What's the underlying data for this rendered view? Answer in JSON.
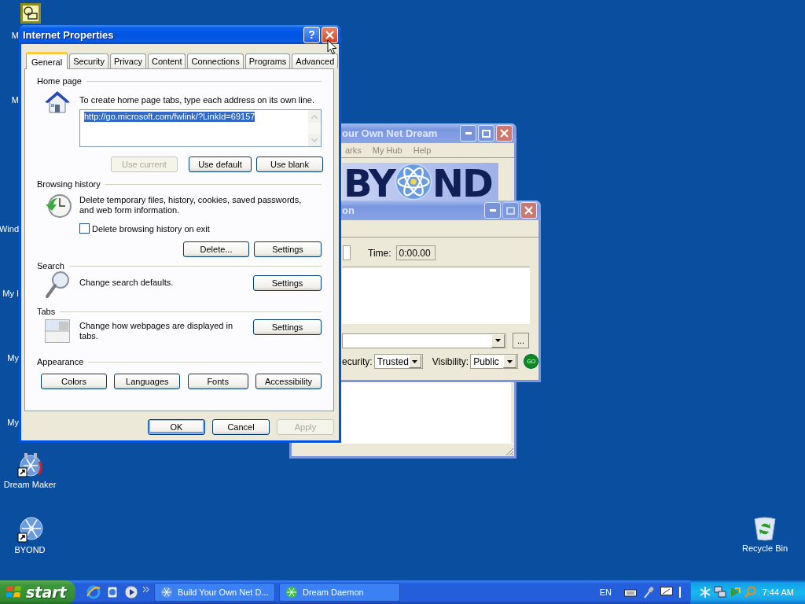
{
  "desktop": {
    "top_labels": [
      "M",
      "M"
    ],
    "lower_labels": [
      "Wind",
      "My I",
      "My",
      "My"
    ],
    "icons": [
      {
        "label": "Dream Maker",
        "kind": "maker"
      },
      {
        "label": "BYOND",
        "kind": "byond"
      },
      {
        "label": "Recycle Bin",
        "kind": "bin"
      }
    ]
  },
  "byond_window": {
    "title": "our Own Net Dream",
    "menu": [
      "arks",
      "My Hub",
      "Help"
    ],
    "logo": [
      "BY",
      "ND"
    ]
  },
  "daemon_window": {
    "title": "on",
    "time_label": "Time:",
    "time_value": "0:00.00",
    "more_button": "...",
    "security_label": "ecurity:",
    "security_value": "Trusted",
    "visibility_label": "Visibility:",
    "visibility_value": "Public",
    "go_button": "GO"
  },
  "dialog": {
    "title": "Internet Properties",
    "help_button": "?",
    "tabs": [
      {
        "label": "General",
        "selected": true
      },
      {
        "label": "Security",
        "selected": false
      },
      {
        "label": "Privacy",
        "selected": false
      },
      {
        "label": "Content",
        "selected": false
      },
      {
        "label": "Connections",
        "selected": false
      },
      {
        "label": "Programs",
        "selected": false
      },
      {
        "label": "Advanced",
        "selected": false
      }
    ],
    "home_page": {
      "heading": "Home page",
      "text": "To create home page tabs, type each address on its own line.",
      "url": "http://go.microsoft.com/fwlink/?LinkId=69157",
      "buttons": [
        {
          "label": "Use current",
          "disabled": true
        },
        {
          "label": "Use default",
          "disabled": false
        },
        {
          "label": "Use blank",
          "disabled": false
        }
      ]
    },
    "browsing_history": {
      "heading": "Browsing history",
      "text": "Delete temporary files, history, cookies, saved passwords, and web form information.",
      "checkbox": {
        "label": "Delete browsing history on exit",
        "checked": false
      },
      "buttons": [
        {
          "label": "Delete...",
          "disabled": false
        },
        {
          "label": "Settings",
          "disabled": false
        }
      ]
    },
    "search": {
      "heading": "Search",
      "text": "Change search defaults.",
      "button": "Settings"
    },
    "tabs_section": {
      "heading": "Tabs",
      "text": "Change how webpages are displayed in tabs.",
      "button": "Settings"
    },
    "appearance": {
      "heading": "Appearance",
      "buttons": [
        "Colors",
        "Languages",
        "Fonts",
        "Accessibility"
      ]
    },
    "footer": [
      {
        "label": "OK",
        "disabled": false,
        "default": true
      },
      {
        "label": "Cancel",
        "disabled": false,
        "default": false
      },
      {
        "label": "Apply",
        "disabled": true,
        "default": false
      }
    ]
  },
  "taskbar": {
    "start": "start",
    "tasks": [
      {
        "label": "Build Your Own Net D...",
        "kind": "byond",
        "selected": false
      },
      {
        "label": "Dream Daemon",
        "kind": "daemon",
        "selected": false
      }
    ],
    "language": "EN",
    "clock": "7:44 AM"
  }
}
